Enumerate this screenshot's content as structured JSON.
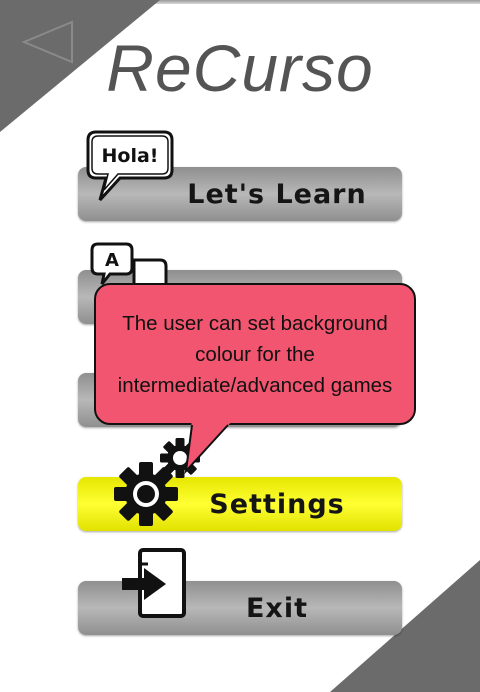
{
  "app": {
    "title": "ReCurso"
  },
  "menu": {
    "items": [
      {
        "label": "Let's Learn",
        "icon": "speech-bubble-hola-icon",
        "icon_text": "Hola!"
      },
      {
        "label": "",
        "icon": "translate-icon",
        "icon_text": "A"
      },
      {
        "label": "",
        "icon": ""
      },
      {
        "label": "Settings",
        "icon": "gear-icon",
        "highlighted": true
      },
      {
        "label": "Exit",
        "icon": "exit-door-icon"
      }
    ]
  },
  "tooltip": {
    "text": "The user can set background colour for the intermediate/advanced games"
  },
  "colors": {
    "corner": "#6b6b6b",
    "button": "#a3a3a3",
    "highlight": "#ffff33",
    "tooltip": "#f25570"
  }
}
